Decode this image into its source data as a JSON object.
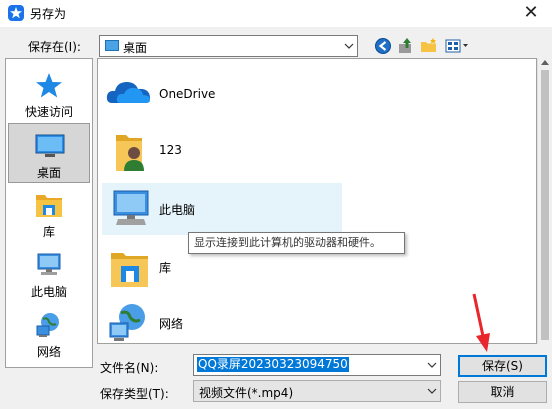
{
  "window": {
    "title": "另存为",
    "close_glyph": "✕"
  },
  "toolbar": {
    "save_in_label": "保存在(I):",
    "location": "桌面",
    "icons": [
      "back-icon",
      "up-folder-icon",
      "new-folder-icon",
      "view-menu-icon"
    ]
  },
  "places": [
    {
      "label": "快速访问",
      "icon": "star-icon",
      "selected": false
    },
    {
      "label": "桌面",
      "icon": "desktop-icon",
      "selected": true
    },
    {
      "label": "库",
      "icon": "library-icon",
      "selected": false
    },
    {
      "label": "此电脑",
      "icon": "computer-icon",
      "selected": false
    },
    {
      "label": "网络",
      "icon": "network-icon",
      "selected": false
    }
  ],
  "files": [
    {
      "name": "OneDrive",
      "icon": "onedrive-cloud-icon"
    },
    {
      "name": "123",
      "icon": "user-folder-icon"
    },
    {
      "name": "此电脑",
      "icon": "computer-icon",
      "hover": true
    },
    {
      "name": "库",
      "icon": "library-icon"
    },
    {
      "name": "网络",
      "icon": "network-icon"
    }
  ],
  "tooltip": "显示连接到此计算机的驱动器和硬件。",
  "filename": {
    "label": "文件名(N):",
    "value": "QQ录屏20230323094750"
  },
  "filetype": {
    "label": "保存类型(T):",
    "value": "视频文件(*.mp4)"
  },
  "buttons": {
    "save": "保存(S)",
    "cancel": "取消"
  },
  "colors": {
    "accent": "#0078d7",
    "hover": "#e5f3fb",
    "annotation_arrow": "#e8262b"
  }
}
